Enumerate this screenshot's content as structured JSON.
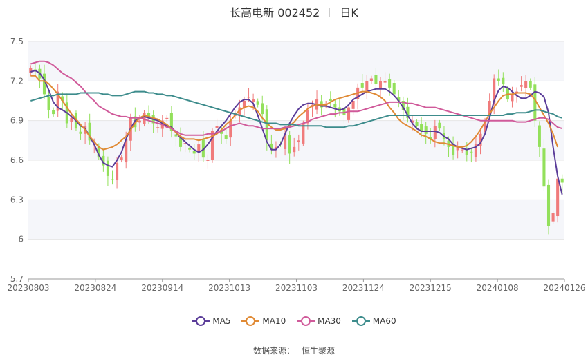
{
  "header": {
    "stock": "长高电新 002452",
    "period": "日K"
  },
  "source": {
    "label": "数据来源：",
    "name": "恒生聚源"
  },
  "colors": {
    "up": "#f07b7b",
    "down": "#93e05b",
    "grid": "#e6e6e6",
    "band": "#f5f6fa"
  },
  "chart_data": {
    "type": "candlestick",
    "title": "长高电新 002452  日K",
    "ylim": [
      5.7,
      7.5
    ],
    "yticks": [
      5.7,
      6,
      6.3,
      6.6,
      6.9,
      7.2,
      7.5
    ],
    "ytick_labels": [
      "5.7",
      "6",
      "6.3",
      "6.6",
      "6.9",
      "7.2",
      "7.5"
    ],
    "xtick_labels": [
      "20230803",
      "20230824",
      "20230914",
      "20231013",
      "20231103",
      "20231124",
      "20231215",
      "20240108",
      "20240126"
    ],
    "legend": {
      "position": "bottom"
    },
    "grid": true,
    "close": [
      7.3,
      7.28,
      7.22,
      7.1,
      6.98,
      6.95,
      7.12,
      7.05,
      6.88,
      6.92,
      6.84,
      6.8,
      6.86,
      6.75,
      6.72,
      6.62,
      6.56,
      6.48,
      6.45,
      6.58,
      6.62,
      6.76,
      6.92,
      6.85,
      6.9,
      6.96,
      6.92,
      6.88,
      6.85,
      6.9,
      6.92,
      6.82,
      6.78,
      6.7,
      6.73,
      6.68,
      6.65,
      6.72,
      6.62,
      6.6,
      6.82,
      6.86,
      6.8,
      6.76,
      6.9,
      6.96,
      7.0,
      7.05,
      7.08,
      7.06,
      7.02,
      6.95,
      6.75,
      6.68,
      6.7,
      6.72,
      6.8,
      6.65,
      6.7,
      6.75,
      6.88,
      6.98,
      7.02,
      7.06,
      7.0,
      7.03,
      7.05,
      7.0,
      6.97,
      6.94,
      7.0,
      7.05,
      7.15,
      7.15,
      7.2,
      7.22,
      7.18,
      7.2,
      7.2,
      7.15,
      7.1,
      7.05,
      6.98,
      6.92,
      6.9,
      6.86,
      6.82,
      6.8,
      6.76,
      6.86,
      6.84,
      6.76,
      6.7,
      6.64,
      6.7,
      6.68,
      6.64,
      6.66,
      6.72,
      6.8,
      6.9,
      7.05,
      7.22,
      7.2,
      7.18,
      7.06,
      7.1,
      7.12,
      7.17,
      7.2,
      7.15,
      6.9,
      6.7,
      6.4,
      6.1,
      6.2,
      6.46,
      6.43
    ],
    "ma5": [
      7.27,
      7.28,
      7.26,
      7.21,
      7.13,
      7.04,
      7.0,
      6.98,
      6.96,
      6.93,
      6.9,
      6.86,
      6.84,
      6.78,
      6.72,
      6.64,
      6.58,
      6.56,
      6.55,
      6.6,
      6.66,
      6.76,
      6.84,
      6.9,
      6.92,
      6.93,
      6.92,
      6.91,
      6.9,
      6.88,
      6.86,
      6.85,
      6.81,
      6.77,
      6.74,
      6.71,
      6.68,
      6.66,
      6.68,
      6.72,
      6.77,
      6.82,
      6.86,
      6.9,
      6.95,
      7.0,
      7.04,
      7.06,
      7.06,
      7.03,
      6.94,
      6.84,
      6.74,
      6.68,
      6.68,
      6.72,
      6.8,
      6.88,
      6.94,
      6.99,
      7.02,
      7.03,
      7.03,
      7.02,
      7.01,
      7.01,
      7.0,
      6.99,
      6.98,
      6.99,
      7.02,
      7.06,
      7.08,
      7.1,
      7.12,
      7.13,
      7.14,
      7.14,
      7.14,
      7.12,
      7.09,
      7.05,
      7.0,
      6.94,
      6.88,
      6.84,
      6.82,
      6.82,
      6.82,
      6.82,
      6.81,
      6.78,
      6.76,
      6.72,
      6.7,
      6.69,
      6.68,
      6.69,
      6.7,
      6.73,
      6.8,
      6.92,
      7.05,
      7.13,
      7.16,
      7.15,
      7.12,
      7.09,
      7.07,
      7.07,
      7.09,
      7.12,
      7.11,
      7.08,
      6.96,
      6.7,
      6.48,
      6.34
    ],
    "ma10": [
      7.24,
      7.24,
      7.2,
      7.2,
      7.18,
      7.14,
      7.1,
      7.05,
      7.0,
      6.95,
      6.91,
      6.87,
      6.83,
      6.78,
      6.74,
      6.7,
      6.68,
      6.69,
      6.7,
      6.72,
      6.75,
      6.78,
      6.83,
      6.88,
      6.92,
      6.94,
      6.93,
      6.92,
      6.91,
      6.89,
      6.87,
      6.84,
      6.81,
      6.78,
      6.76,
      6.76,
      6.76,
      6.75,
      6.76,
      6.77,
      6.78,
      6.8,
      6.83,
      6.87,
      6.9,
      6.94,
      6.98,
      7.0,
      7.01,
      7.0,
      6.97,
      6.92,
      6.88,
      6.85,
      6.83,
      6.83,
      6.84,
      6.86,
      6.89,
      6.93,
      6.96,
      6.99,
      7.01,
      7.02,
      7.02,
      7.02,
      7.04,
      7.06,
      7.07,
      7.08,
      7.09,
      7.1,
      7.11,
      7.12,
      7.12,
      7.11,
      7.1,
      7.08,
      7.05,
      7.0,
      6.96,
      6.91,
      6.88,
      6.86,
      6.84,
      6.82,
      6.79,
      6.78,
      6.76,
      6.74,
      6.73,
      6.73,
      6.72,
      6.71,
      6.7,
      6.7,
      6.71,
      6.74,
      6.78,
      6.83,
      6.89,
      6.95,
      7.0,
      7.05,
      7.09,
      7.1,
      7.1,
      7.11,
      7.11,
      7.11,
      7.1,
      7.06,
      7.0,
      6.94,
      6.88,
      6.8,
      6.7
    ],
    "ma30": [
      7.33,
      7.34,
      7.35,
      7.35,
      7.34,
      7.32,
      7.29,
      7.26,
      7.24,
      7.22,
      7.19,
      7.16,
      7.12,
      7.08,
      7.05,
      7.01,
      6.99,
      6.97,
      6.95,
      6.94,
      6.93,
      6.93,
      6.92,
      6.92,
      6.92,
      6.91,
      6.9,
      6.89,
      6.88,
      6.87,
      6.85,
      6.84,
      6.82,
      6.8,
      6.79,
      6.79,
      6.79,
      6.79,
      6.79,
      6.8,
      6.8,
      6.81,
      6.82,
      6.84,
      6.86,
      6.87,
      6.88,
      6.87,
      6.86,
      6.86,
      6.85,
      6.84,
      6.84,
      6.84,
      6.84,
      6.84,
      6.85,
      6.85,
      6.86,
      6.87,
      6.88,
      6.89,
      6.91,
      6.92,
      6.93,
      6.94,
      6.95,
      6.95,
      6.96,
      6.96,
      6.97,
      6.97,
      6.97,
      6.98,
      6.99,
      7.0,
      7.01,
      7.02,
      7.03,
      7.04,
      7.04,
      7.04,
      7.04,
      7.03,
      7.03,
      7.02,
      7.01,
      7.0,
      7.0,
      7.0,
      6.99,
      6.98,
      6.97,
      6.96,
      6.95,
      6.94,
      6.93,
      6.92,
      6.91,
      6.9,
      6.9,
      6.9,
      6.9,
      6.9,
      6.9,
      6.9,
      6.9,
      6.89,
      6.89,
      6.89,
      6.9,
      6.91,
      6.92,
      6.92,
      6.91,
      6.88,
      6.85,
      6.84
    ],
    "ma60": [
      7.05,
      7.06,
      7.07,
      7.08,
      7.09,
      7.09,
      7.1,
      7.1,
      7.1,
      7.1,
      7.1,
      7.11,
      7.11,
      7.11,
      7.11,
      7.11,
      7.1,
      7.1,
      7.09,
      7.09,
      7.09,
      7.1,
      7.11,
      7.12,
      7.12,
      7.12,
      7.11,
      7.11,
      7.1,
      7.1,
      7.09,
      7.09,
      7.08,
      7.07,
      7.06,
      7.05,
      7.04,
      7.03,
      7.02,
      7.01,
      7.0,
      6.99,
      6.98,
      6.97,
      6.96,
      6.95,
      6.94,
      6.93,
      6.92,
      6.91,
      6.9,
      6.89,
      6.88,
      6.88,
      6.88,
      6.87,
      6.87,
      6.87,
      6.87,
      6.86,
      6.86,
      6.86,
      6.86,
      6.86,
      6.86,
      6.85,
      6.85,
      6.85,
      6.85,
      6.85,
      6.86,
      6.86,
      6.87,
      6.88,
      6.89,
      6.9,
      6.91,
      6.92,
      6.93,
      6.94,
      6.94,
      6.94,
      6.94,
      6.94,
      6.94,
      6.94,
      6.94,
      6.94,
      6.94,
      6.94,
      6.94,
      6.94,
      6.94,
      6.94,
      6.94,
      6.94,
      6.94,
      6.94,
      6.94,
      6.94,
      6.94,
      6.94,
      6.94,
      6.94,
      6.94,
      6.95,
      6.95,
      6.96,
      6.96,
      6.96,
      6.97,
      6.98,
      6.98,
      6.97,
      6.96,
      6.95,
      6.93,
      6.92
    ],
    "series": [
      {
        "name": "MA5",
        "color": "#5b3d99"
      },
      {
        "name": "MA10",
        "color": "#e08a35"
      },
      {
        "name": "MA30",
        "color": "#d05a9a"
      },
      {
        "name": "MA60",
        "color": "#3d8c8c"
      }
    ]
  }
}
